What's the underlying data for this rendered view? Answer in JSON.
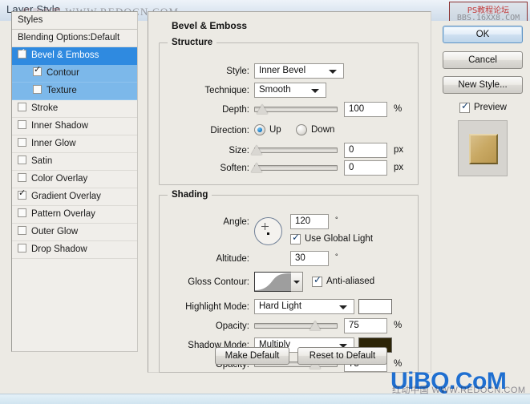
{
  "window": {
    "title": "Layer Style"
  },
  "watermarks": {
    "title_overlay_cn": "红动中国",
    "title_overlay": "WWW.REDOCN.COM",
    "topright_line1": "PS教程论坛",
    "topright_line2": "BBS.16XX8.COM",
    "bottomright": "UiBQ.CoM",
    "bottomright_sub": "红动中国 WWW.REDOCN.COM"
  },
  "styles_panel": {
    "header": "Styles",
    "items": [
      {
        "label": "Blending Options:Default",
        "checkbox": false,
        "has_checkbox": false,
        "selected": false,
        "indent": false
      },
      {
        "label": "Bevel & Emboss",
        "checkbox": true,
        "has_checkbox": true,
        "selected": true,
        "indent": false
      },
      {
        "label": "Contour",
        "checkbox": true,
        "has_checkbox": true,
        "selected": false,
        "sub_selected": true,
        "indent": true
      },
      {
        "label": "Texture",
        "checkbox": false,
        "has_checkbox": true,
        "selected": false,
        "sub_selected": true,
        "indent": true
      },
      {
        "label": "Stroke",
        "checkbox": false,
        "has_checkbox": true,
        "selected": false,
        "indent": false
      },
      {
        "label": "Inner Shadow",
        "checkbox": false,
        "has_checkbox": true,
        "selected": false,
        "indent": false
      },
      {
        "label": "Inner Glow",
        "checkbox": false,
        "has_checkbox": true,
        "selected": false,
        "indent": false
      },
      {
        "label": "Satin",
        "checkbox": false,
        "has_checkbox": true,
        "selected": false,
        "indent": false
      },
      {
        "label": "Color Overlay",
        "checkbox": false,
        "has_checkbox": true,
        "selected": false,
        "indent": false
      },
      {
        "label": "Gradient Overlay",
        "checkbox": true,
        "has_checkbox": true,
        "selected": false,
        "indent": false
      },
      {
        "label": "Pattern Overlay",
        "checkbox": false,
        "has_checkbox": true,
        "selected": false,
        "indent": false
      },
      {
        "label": "Outer Glow",
        "checkbox": false,
        "has_checkbox": true,
        "selected": false,
        "indent": false
      },
      {
        "label": "Drop Shadow",
        "checkbox": false,
        "has_checkbox": true,
        "selected": false,
        "indent": false
      }
    ]
  },
  "main": {
    "title": "Bevel & Emboss",
    "structure": {
      "legend": "Structure",
      "style_label": "Style:",
      "style_value": "Inner Bevel",
      "technique_label": "Technique:",
      "technique_value": "Smooth",
      "depth_label": "Depth:",
      "depth_value": "100",
      "depth_unit": "%",
      "depth_percent": 10,
      "direction_label": "Direction:",
      "direction_up": "Up",
      "direction_down": "Down",
      "direction_selected": "Up",
      "size_label": "Size:",
      "size_value": "0",
      "size_unit": "px",
      "size_percent": 0,
      "soften_label": "Soften:",
      "soften_value": "0",
      "soften_unit": "px",
      "soften_percent": 0
    },
    "shading": {
      "legend": "Shading",
      "angle_label": "Angle:",
      "angle_value": "120",
      "angle_unit": "°",
      "use_global_light": "Use Global Light",
      "use_global_light_checked": true,
      "altitude_label": "Altitude:",
      "altitude_value": "30",
      "altitude_unit": "°",
      "gloss_contour_label": "Gloss Contour:",
      "anti_aliased": "Anti-aliased",
      "anti_aliased_checked": true,
      "highlight_mode_label": "Highlight Mode:",
      "highlight_mode_value": "Hard Light",
      "highlight_color": "#ffffff",
      "highlight_opacity_label": "Opacity:",
      "highlight_opacity_value": "75",
      "highlight_opacity_unit": "%",
      "highlight_opacity_percent": 73,
      "shadow_mode_label": "Shadow Mode:",
      "shadow_mode_value": "Multiply",
      "shadow_color": "#2d2508",
      "shadow_opacity_label": "Opacity:",
      "shadow_opacity_value": "75",
      "shadow_opacity_unit": "%",
      "shadow_opacity_percent": 73
    },
    "make_default": "Make Default",
    "reset_to_default": "Reset to Default"
  },
  "side": {
    "ok": "OK",
    "cancel": "Cancel",
    "new_style": "New Style...",
    "preview_label": "Preview",
    "preview_checked": true,
    "thumbnail_color": "#c9a964"
  }
}
